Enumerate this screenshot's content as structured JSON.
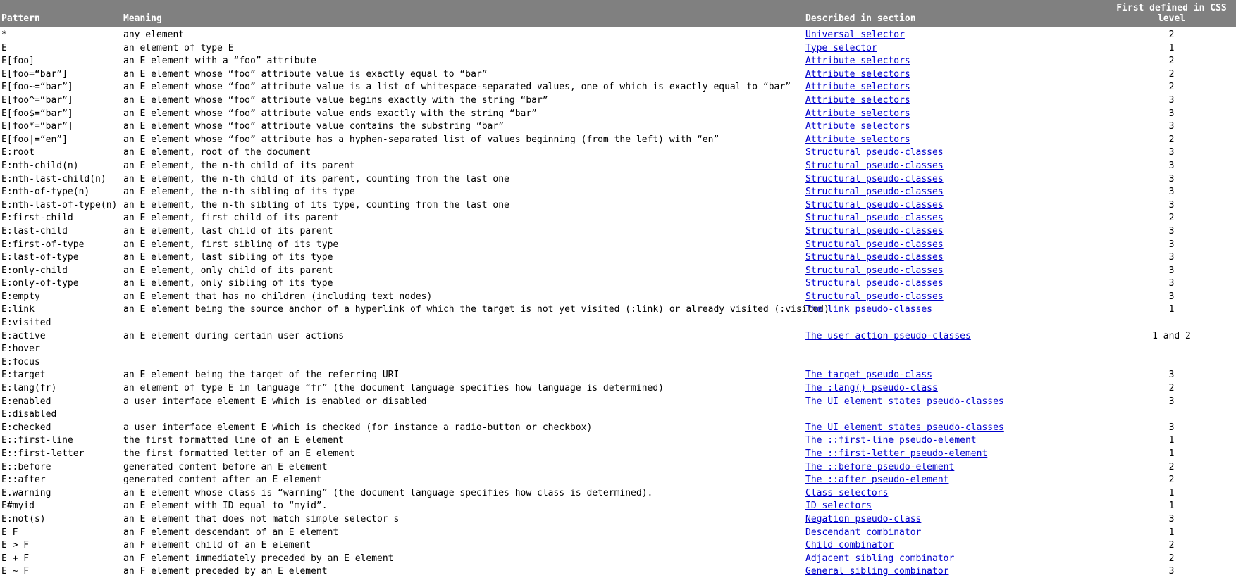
{
  "header": {
    "columns": [
      {
        "key": "pattern",
        "label": "Pattern",
        "align": "left"
      },
      {
        "key": "meaning",
        "label": "Meaning",
        "align": "left"
      },
      {
        "key": "section",
        "label": "Described in section",
        "align": "left"
      },
      {
        "key": "level",
        "label": "First defined in CSS level",
        "align": "center"
      }
    ],
    "background_color": "#808080",
    "text_color": "#ffffff"
  },
  "style": {
    "link_color": "#0000cc",
    "text_color": "#000000",
    "page_background": "#ffffff"
  },
  "rows": [
    {
      "pattern": [
        "*"
      ],
      "meaning": "any element",
      "section": "Universal selector",
      "level": "2"
    },
    {
      "pattern": [
        "E"
      ],
      "meaning": "an element of type E",
      "section": "Type selector",
      "level": "1"
    },
    {
      "pattern": [
        "E[foo]"
      ],
      "meaning": "an E element with a “foo” attribute",
      "section": "Attribute selectors",
      "level": "2"
    },
    {
      "pattern": [
        "E[foo=“bar”]"
      ],
      "meaning": "an E element whose “foo” attribute value is exactly equal to “bar”",
      "section": "Attribute selectors",
      "level": "2"
    },
    {
      "pattern": [
        "E[foo~=“bar”]"
      ],
      "meaning": "an E element whose “foo” attribute value is a list of whitespace-separated values, one of which is exactly equal to “bar”",
      "section": "Attribute selectors",
      "level": "2"
    },
    {
      "pattern": [
        "E[foo^=“bar”]"
      ],
      "meaning": "an E element whose “foo” attribute value begins exactly with the string “bar”",
      "section": "Attribute selectors",
      "level": "3"
    },
    {
      "pattern": [
        "E[foo$=“bar”]"
      ],
      "meaning": "an E element whose “foo” attribute value ends exactly with the string “bar”",
      "section": "Attribute selectors",
      "level": "3"
    },
    {
      "pattern": [
        "E[foo*=“bar”]"
      ],
      "meaning": "an E element whose “foo” attribute value contains the substring “bar”",
      "section": "Attribute selectors",
      "level": "3"
    },
    {
      "pattern": [
        "E[foo|=“en”]"
      ],
      "meaning": "an E element whose “foo” attribute has a hyphen-separated list of values beginning (from the left) with “en”",
      "section": "Attribute selectors",
      "level": "2"
    },
    {
      "pattern": [
        "E:root"
      ],
      "meaning": "an E element, root of the document",
      "section": "Structural pseudo-classes",
      "level": "3"
    },
    {
      "pattern": [
        "E:nth-child(n)"
      ],
      "meaning": "an E element, the n-th child of its parent",
      "section": "Structural pseudo-classes",
      "level": "3"
    },
    {
      "pattern": [
        "E:nth-last-child(n)"
      ],
      "meaning": "an E element, the n-th child of its parent, counting from the last one",
      "section": "Structural pseudo-classes",
      "level": "3"
    },
    {
      "pattern": [
        "E:nth-of-type(n)"
      ],
      "meaning": "an E element, the n-th sibling of its type",
      "section": "Structural pseudo-classes",
      "level": "3"
    },
    {
      "pattern": [
        "E:nth-last-of-type(n)"
      ],
      "meaning": "an E element, the n-th sibling of its type, counting from the last one",
      "section": "Structural pseudo-classes",
      "level": "3"
    },
    {
      "pattern": [
        "E:first-child"
      ],
      "meaning": "an E element, first child of its parent",
      "section": "Structural pseudo-classes",
      "level": "2"
    },
    {
      "pattern": [
        "E:last-child"
      ],
      "meaning": "an E element, last child of its parent",
      "section": "Structural pseudo-classes",
      "level": "3"
    },
    {
      "pattern": [
        "E:first-of-type"
      ],
      "meaning": "an E element, first sibling of its type",
      "section": "Structural pseudo-classes",
      "level": "3"
    },
    {
      "pattern": [
        "E:last-of-type"
      ],
      "meaning": "an E element, last sibling of its type",
      "section": "Structural pseudo-classes",
      "level": "3"
    },
    {
      "pattern": [
        "E:only-child"
      ],
      "meaning": "an E element, only child of its parent",
      "section": "Structural pseudo-classes",
      "level": "3"
    },
    {
      "pattern": [
        "E:only-of-type"
      ],
      "meaning": "an E element, only sibling of its type",
      "section": "Structural pseudo-classes",
      "level": "3"
    },
    {
      "pattern": [
        "E:empty"
      ],
      "meaning": "an E element that has no children (including text nodes)",
      "section": "Structural pseudo-classes",
      "level": "3"
    },
    {
      "pattern": [
        "E:link",
        "E:visited"
      ],
      "meaning": "an E element being the source anchor of a hyperlink of which the target is not yet visited (:link) or already visited (:visited)",
      "section": "The link pseudo-classes",
      "level": "1"
    },
    {
      "pattern": [
        "E:active",
        "E:hover",
        "E:focus"
      ],
      "meaning": "an E element during certain user actions",
      "section": "The user action pseudo-classes",
      "level": "1 and 2"
    },
    {
      "pattern": [
        "E:target"
      ],
      "meaning": "an E element being the target of the referring URI",
      "section": "The target pseudo-class",
      "level": "3"
    },
    {
      "pattern": [
        "E:lang(fr)"
      ],
      "meaning": "an element of type E in language “fr” (the document language specifies how language is determined)",
      "section": "The :lang() pseudo-class",
      "level": "2"
    },
    {
      "pattern": [
        "E:enabled",
        "E:disabled"
      ],
      "meaning": "a user interface element E which is enabled or disabled",
      "section": "The UI element states pseudo-classes",
      "level": "3"
    },
    {
      "pattern": [
        "E:checked"
      ],
      "meaning": "a user interface element E which is checked (for instance a radio-button or checkbox)",
      "section": "The UI element states pseudo-classes",
      "level": "3"
    },
    {
      "pattern": [
        "E::first-line"
      ],
      "meaning": "the first formatted line of an E element",
      "section": "The ::first-line pseudo-element",
      "level": "1"
    },
    {
      "pattern": [
        "E::first-letter"
      ],
      "meaning": "the first formatted letter of an E element",
      "section": "The ::first-letter pseudo-element",
      "level": "1"
    },
    {
      "pattern": [
        "E::before"
      ],
      "meaning": "generated content before an E element",
      "section": "The ::before pseudo-element",
      "level": "2"
    },
    {
      "pattern": [
        "E::after"
      ],
      "meaning": "generated content after an E element",
      "section": "The ::after pseudo-element",
      "level": "2"
    },
    {
      "pattern": [
        "E.warning"
      ],
      "meaning": "an E element whose class is “warning” (the document language specifies how class is determined).",
      "section": "Class selectors",
      "level": "1"
    },
    {
      "pattern": [
        "E#myid"
      ],
      "meaning": "an E element with ID equal to “myid”.",
      "section": "ID selectors",
      "level": "1"
    },
    {
      "pattern": [
        "E:not(s)"
      ],
      "meaning": "an E element that does not match simple selector s",
      "section": "Negation pseudo-class",
      "level": "3"
    },
    {
      "pattern": [
        "E F"
      ],
      "meaning": "an F element descendant of an E element",
      "section": "Descendant combinator",
      "level": "1"
    },
    {
      "pattern": [
        "E > F"
      ],
      "meaning": "an F element child of an E element",
      "section": "Child combinator",
      "level": "2"
    },
    {
      "pattern": [
        "E + F"
      ],
      "meaning": "an F element immediately preceded by an E element",
      "section": "Adjacent sibling combinator",
      "level": "2"
    },
    {
      "pattern": [
        "E ~ F"
      ],
      "meaning": "an F element preceded by an E element",
      "section": "General sibling combinator",
      "level": "3"
    }
  ]
}
